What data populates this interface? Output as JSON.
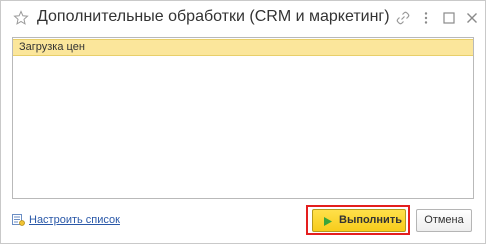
{
  "window": {
    "title": "Дополнительные обработки (CRM и маркетинг)",
    "icons": [
      "star-icon",
      "link-icon",
      "more-icon",
      "maximize-icon",
      "close-icon"
    ]
  },
  "list": {
    "items": [
      {
        "label": "Загрузка цен",
        "selected": true
      }
    ]
  },
  "footer": {
    "settings_link": "Настроить список",
    "run_label": "Выполнить",
    "cancel_label": "Отмена"
  },
  "colors": {
    "selection": "#fbe69b",
    "primary_button": "#f7cc1b",
    "highlight_frame": "#e41e1e",
    "link": "#2a58a8",
    "play_icon": "#3aa53a"
  }
}
